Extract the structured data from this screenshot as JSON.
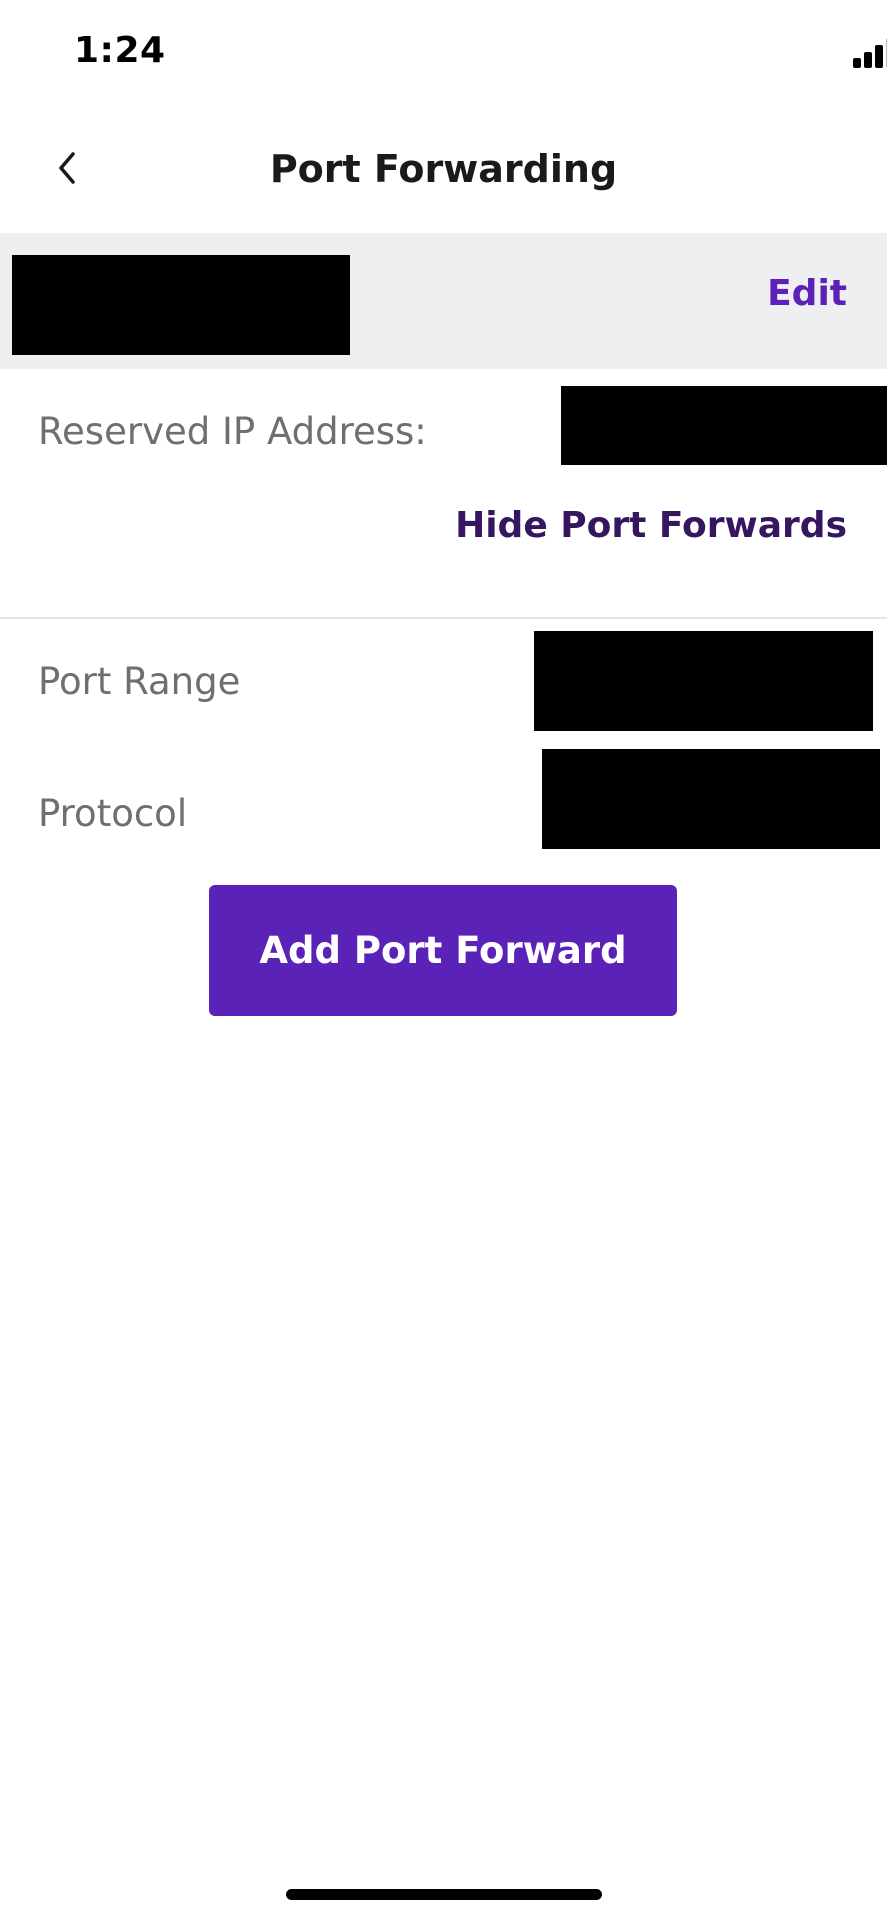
{
  "status_bar": {
    "time": "1:24",
    "icons": [
      "signal-icon",
      "wifi-icon",
      "battery-icon"
    ]
  },
  "header": {
    "title": "Port Forwarding",
    "back_icon": "chevron-left-icon"
  },
  "device": {
    "edit_label": "Edit"
  },
  "reserved_ip": {
    "label": "Reserved IP Address:"
  },
  "port_forwards": {
    "toggle_label": "Hide Port Forwards",
    "rows": [
      {
        "label": "Port Range"
      },
      {
        "label": "Protocol"
      }
    ]
  },
  "actions": {
    "add_label": "Add Port Forward"
  },
  "colors": {
    "accent": "#5b22b8",
    "link_dark": "#35165f",
    "band_bg": "#efeff2",
    "label_gray": "#6f6f6f"
  }
}
